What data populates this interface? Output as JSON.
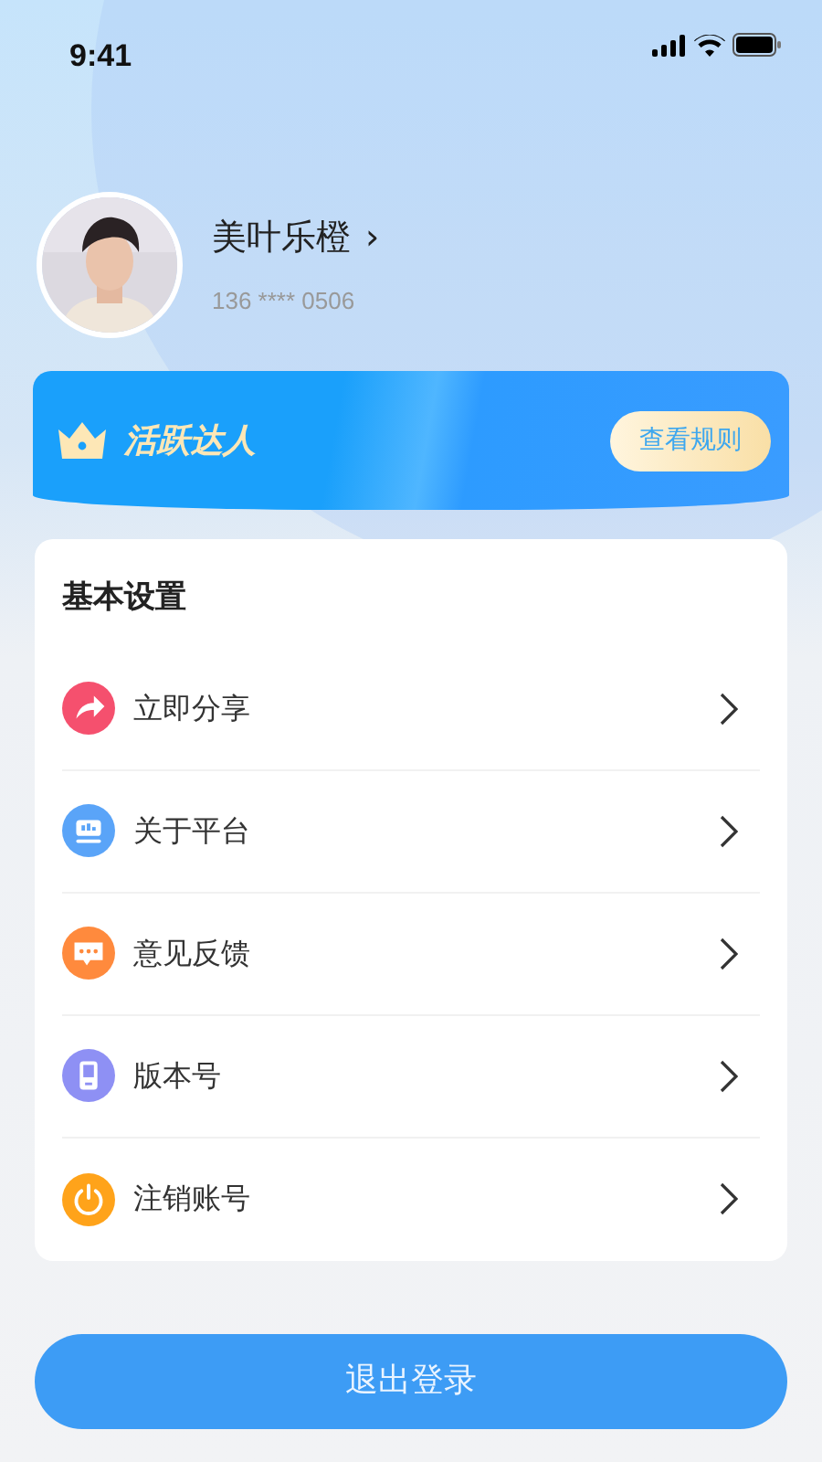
{
  "status_bar": {
    "time": "9:41"
  },
  "profile": {
    "name": "美叶乐橙",
    "chevron": "›",
    "phone": "136 **** 0506"
  },
  "banner": {
    "title": "活跃达人",
    "button": "查看规则"
  },
  "settings": {
    "title": "基本设置",
    "items": [
      {
        "label": "立即分享",
        "color": "#f5506e"
      },
      {
        "label": "关于平台",
        "color": "#5aa4f8"
      },
      {
        "label": "意见反馈",
        "color": "#ff8a3d"
      },
      {
        "label": "版本号",
        "color": "#8e90f4"
      },
      {
        "label": "注销账号",
        "color": "#ffa31a"
      }
    ]
  },
  "logout_button": "退出登录"
}
